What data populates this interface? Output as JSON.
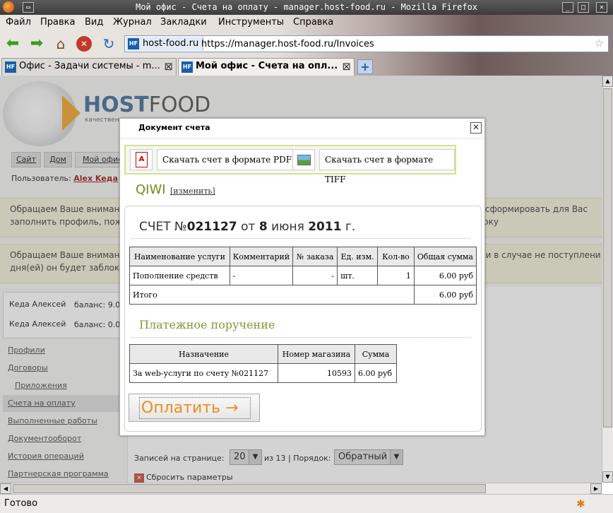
{
  "window": {
    "title": "Мой офис - Счета на оплату - manager.host-food.ru - Mozilla Firefox"
  },
  "menu": [
    "Файл",
    "Правка",
    "Вид",
    "Журнал",
    "Закладки",
    "Инструменты",
    "Справка"
  ],
  "address": {
    "site": "host-food.ru",
    "url": "https://manager.host-food.ru/Invoices"
  },
  "tabs": [
    {
      "label": "Офис - Задачи системы - m...",
      "active": false
    },
    {
      "label": "Мой офис - Счета на опл...",
      "active": true
    }
  ],
  "site": {
    "brand_host": "HOST",
    "brand_food": "FOOD",
    "tagline": "качественн",
    "nav": [
      "Сайт",
      "Дом",
      "Мой офис"
    ],
    "user_label": "Пользователь:",
    "user_name": "Alex Keда",
    "notice1_line1": "Обращаем Ваше внимание,",
    "notice1_line1_right": "ь сформировать для Вас доку",
    "notice1_line2": "заполнить профиль, пожа",
    "notice2_line1": "Обращаем Ваше внимание,",
    "notice2_line1_right": "й и в случае не поступлени",
    "notice2_line2": "дня(ей) он будет заблоки",
    "accounts": [
      {
        "name": "Кеда Алексей",
        "balance": "баланс: 9.0"
      },
      {
        "name": "Кеда Алексей",
        "balance": "баланс: 0.0"
      }
    ],
    "sidebar": [
      "Профили",
      "Договоры",
      "Приложения",
      "Счета на оплату",
      "Выполненные работы",
      "Документооборот",
      "История операций",
      "Партнерская программа"
    ],
    "pager": {
      "per_page_label": "Записей на странице:",
      "per_page": "20",
      "of": "из 13 | Порядок:",
      "order": "Обратный"
    },
    "reset_label": "Сбросить параметры"
  },
  "modal": {
    "title": "Документ счета",
    "pdf_label": "Скачать счет в формате PDF",
    "tiff_label": "Скачать счет в формате TIFF",
    "method": "QIWI",
    "change_label": "[изменить]",
    "invoice_prefix": "СЧЕТ №",
    "invoice_number": "021127",
    "invoice_from": "от",
    "invoice_day": "8",
    "invoice_month": "июня",
    "invoice_year": "2011",
    "invoice_suffix": "г.",
    "table_headers": [
      "Наименование услуги",
      "Комментарий",
      "№ заказа",
      "Ед. изм.",
      "Кол-во",
      "Общая сумма"
    ],
    "table_row": [
      "Пополнение средств",
      "-",
      "-",
      "шт.",
      "1",
      "6.00 руб"
    ],
    "total_label": "Итого",
    "total_value": "6.00 руб",
    "payment_title": "Платежное поручение",
    "pay_headers": [
      "Назначение",
      "Номер магазина",
      "Сумма"
    ],
    "pay_row": [
      "За web-услуги по счету №021127",
      "10593",
      "6.00 руб"
    ],
    "pay_button": "Оплатить →"
  },
  "status": "Готово"
}
